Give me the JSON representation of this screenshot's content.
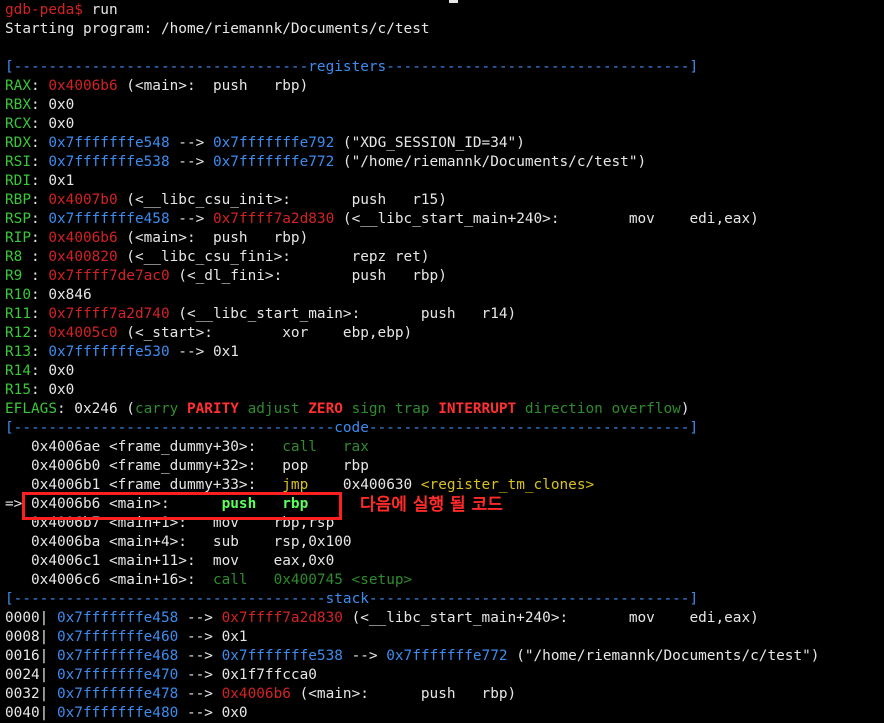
{
  "colors": {
    "default": "#e6e6e6",
    "green": "#39c839",
    "red": "#d42222",
    "blue": "#3c8cf0",
    "yellow": "#d8c020",
    "bright_red": "#ff3030",
    "bright_green": "#5cff5c",
    "dark_green": "#2e8b2e",
    "highlight": "#ff1f1f"
  },
  "annotation": {
    "text": "다음에 실행 될 코드"
  },
  "lines": [
    [
      {
        "t": "gdb-peda$ ",
        "c": "red"
      },
      {
        "t": "run",
        "c": "default"
      }
    ],
    [
      {
        "t": "Starting program: /home/riemannk/Documents/c/test",
        "c": "default"
      }
    ],
    [],
    [
      {
        "t": "[----------------------------------",
        "c": "blue"
      },
      {
        "t": "registers",
        "c": "blue"
      },
      {
        "t": "-----------------------------------]",
        "c": "blue"
      }
    ],
    [
      {
        "t": "RAX",
        "c": "green"
      },
      {
        "t": ": ",
        "c": "default"
      },
      {
        "t": "0x4006b6",
        "c": "red"
      },
      {
        "t": " (<main>:  push   rbp)",
        "c": "default"
      }
    ],
    [
      {
        "t": "RBX",
        "c": "green"
      },
      {
        "t": ": 0x0",
        "c": "default"
      }
    ],
    [
      {
        "t": "RCX",
        "c": "green"
      },
      {
        "t": ": 0x0",
        "c": "default"
      }
    ],
    [
      {
        "t": "RDX",
        "c": "green"
      },
      {
        "t": ": ",
        "c": "default"
      },
      {
        "t": "0x7fffffffe548",
        "c": "blue"
      },
      {
        "t": " --> ",
        "c": "default"
      },
      {
        "t": "0x7fffffffe792",
        "c": "blue"
      },
      {
        "t": " (\"XDG_SESSION_ID=34\")",
        "c": "default"
      }
    ],
    [
      {
        "t": "RSI",
        "c": "green"
      },
      {
        "t": ": ",
        "c": "default"
      },
      {
        "t": "0x7fffffffe538",
        "c": "blue"
      },
      {
        "t": " --> ",
        "c": "default"
      },
      {
        "t": "0x7fffffffe772",
        "c": "blue"
      },
      {
        "t": " (\"/home/riemannk/Documents/c/test\")",
        "c": "default"
      }
    ],
    [
      {
        "t": "RDI",
        "c": "green"
      },
      {
        "t": ": 0x1",
        "c": "default"
      }
    ],
    [
      {
        "t": "RBP",
        "c": "green"
      },
      {
        "t": ": ",
        "c": "default"
      },
      {
        "t": "0x4007b0",
        "c": "red"
      },
      {
        "t": " (<__libc_csu_init>:       push   r15)",
        "c": "default"
      }
    ],
    [
      {
        "t": "RSP",
        "c": "green"
      },
      {
        "t": ": ",
        "c": "default"
      },
      {
        "t": "0x7fffffffe458",
        "c": "blue"
      },
      {
        "t": " --> ",
        "c": "default"
      },
      {
        "t": "0x7ffff7a2d830",
        "c": "red"
      },
      {
        "t": " (<__libc_start_main+240>:        mov    edi,eax)",
        "c": "default"
      }
    ],
    [
      {
        "t": "RIP",
        "c": "green"
      },
      {
        "t": ": ",
        "c": "default"
      },
      {
        "t": "0x4006b6",
        "c": "red"
      },
      {
        "t": " (<main>:  push   rbp)",
        "c": "default"
      }
    ],
    [
      {
        "t": "R8 ",
        "c": "green"
      },
      {
        "t": ": ",
        "c": "default"
      },
      {
        "t": "0x400820",
        "c": "red"
      },
      {
        "t": " (<__libc_csu_fini>:       repz ret)",
        "c": "default"
      }
    ],
    [
      {
        "t": "R9 ",
        "c": "green"
      },
      {
        "t": ": ",
        "c": "default"
      },
      {
        "t": "0x7ffff7de7ac0",
        "c": "red"
      },
      {
        "t": " (<_dl_fini>:        push   rbp)",
        "c": "default"
      }
    ],
    [
      {
        "t": "R10",
        "c": "green"
      },
      {
        "t": ": 0x846",
        "c": "default"
      }
    ],
    [
      {
        "t": "R11",
        "c": "green"
      },
      {
        "t": ": ",
        "c": "default"
      },
      {
        "t": "0x7ffff7a2d740",
        "c": "red"
      },
      {
        "t": " (<__libc_start_main>:       push   r14)",
        "c": "default"
      }
    ],
    [
      {
        "t": "R12",
        "c": "green"
      },
      {
        "t": ": ",
        "c": "default"
      },
      {
        "t": "0x4005c0",
        "c": "red"
      },
      {
        "t": " (<_start>:        xor    ebp,ebp)",
        "c": "default"
      }
    ],
    [
      {
        "t": "R13",
        "c": "green"
      },
      {
        "t": ": ",
        "c": "default"
      },
      {
        "t": "0x7fffffffe530",
        "c": "blue"
      },
      {
        "t": " --> 0x1",
        "c": "default"
      }
    ],
    [
      {
        "t": "R14",
        "c": "green"
      },
      {
        "t": ": 0x0",
        "c": "default"
      }
    ],
    [
      {
        "t": "R15",
        "c": "green"
      },
      {
        "t": ": 0x0",
        "c": "default"
      }
    ],
    [
      {
        "t": "EFLAGS",
        "c": "green"
      },
      {
        "t": ": 0x246 (",
        "c": "default"
      },
      {
        "t": "carry ",
        "c": "dark_green"
      },
      {
        "t": "PARITY",
        "c": "bright_red",
        "b": true
      },
      {
        "t": " adjust ",
        "c": "dark_green"
      },
      {
        "t": "ZERO",
        "c": "bright_red",
        "b": true
      },
      {
        "t": " sign trap ",
        "c": "dark_green"
      },
      {
        "t": "INTERRUPT",
        "c": "bright_red",
        "b": true
      },
      {
        "t": " direction overflow",
        "c": "dark_green"
      },
      {
        "t": ")",
        "c": "default"
      }
    ],
    [
      {
        "t": "[-------------------------------------",
        "c": "blue"
      },
      {
        "t": "code",
        "c": "blue"
      },
      {
        "t": "-------------------------------------]",
        "c": "blue"
      }
    ],
    [
      {
        "t": "   0x4006ae <frame_dummy+30>:   ",
        "c": "default"
      },
      {
        "t": "call   rax",
        "c": "dark_green"
      }
    ],
    [
      {
        "t": "   0x4006b0 <frame_dummy+32>:   pop    rbp",
        "c": "default"
      }
    ],
    [
      {
        "t": "   0x4006b1 <frame_dummy+33>:   ",
        "c": "default"
      },
      {
        "t": "jmp    ",
        "c": "yellow"
      },
      {
        "t": "0x400630 ",
        "c": "default"
      },
      {
        "t": "<register_tm_clones>",
        "c": "yellow"
      }
    ],
    [
      {
        "t": "=> 0x4006b6 <main>:      ",
        "c": "default"
      },
      {
        "t": "push   rbp",
        "c": "bright_green",
        "b": true
      }
    ],
    [
      {
        "t": "   0x4006b7 <main+1>:   mov    rbp,rsp",
        "c": "default"
      }
    ],
    [
      {
        "t": "   0x4006ba <main+4>:   sub    rsp,0x100",
        "c": "default"
      }
    ],
    [
      {
        "t": "   0x4006c1 <main+11>:  mov    eax,0x0",
        "c": "default"
      }
    ],
    [
      {
        "t": "   0x4006c6 <main+16>:  ",
        "c": "default"
      },
      {
        "t": "call   0x400745 <setup>",
        "c": "dark_green"
      }
    ],
    [
      {
        "t": "[------------------------------------",
        "c": "blue"
      },
      {
        "t": "stack",
        "c": "blue"
      },
      {
        "t": "-------------------------------------]",
        "c": "blue"
      }
    ],
    [
      {
        "t": "0000| ",
        "c": "default"
      },
      {
        "t": "0x7fffffffe458",
        "c": "blue"
      },
      {
        "t": " --> ",
        "c": "default"
      },
      {
        "t": "0x7ffff7a2d830",
        "c": "red"
      },
      {
        "t": " (<__libc_start_main+240>:       mov    edi,eax)",
        "c": "default"
      }
    ],
    [
      {
        "t": "0008| ",
        "c": "default"
      },
      {
        "t": "0x7fffffffe460",
        "c": "blue"
      },
      {
        "t": " --> 0x1",
        "c": "default"
      }
    ],
    [
      {
        "t": "0016| ",
        "c": "default"
      },
      {
        "t": "0x7fffffffe468",
        "c": "blue"
      },
      {
        "t": " --> ",
        "c": "default"
      },
      {
        "t": "0x7fffffffe538",
        "c": "blue"
      },
      {
        "t": " --> ",
        "c": "default"
      },
      {
        "t": "0x7fffffffe772",
        "c": "blue"
      },
      {
        "t": " (\"/home/riemannk/Documents/c/test\")",
        "c": "default"
      }
    ],
    [
      {
        "t": "0024| ",
        "c": "default"
      },
      {
        "t": "0x7fffffffe470",
        "c": "blue"
      },
      {
        "t": " --> 0x1f7ffcca0",
        "c": "default"
      }
    ],
    [
      {
        "t": "0032| ",
        "c": "default"
      },
      {
        "t": "0x7fffffffe478",
        "c": "blue"
      },
      {
        "t": " --> ",
        "c": "default"
      },
      {
        "t": "0x4006b6",
        "c": "red"
      },
      {
        "t": " (<main>:      push   rbp)",
        "c": "default"
      }
    ],
    [
      {
        "t": "0040| ",
        "c": "default"
      },
      {
        "t": "0x7fffffffe480",
        "c": "blue"
      },
      {
        "t": " --> 0x0",
        "c": "default"
      }
    ]
  ]
}
